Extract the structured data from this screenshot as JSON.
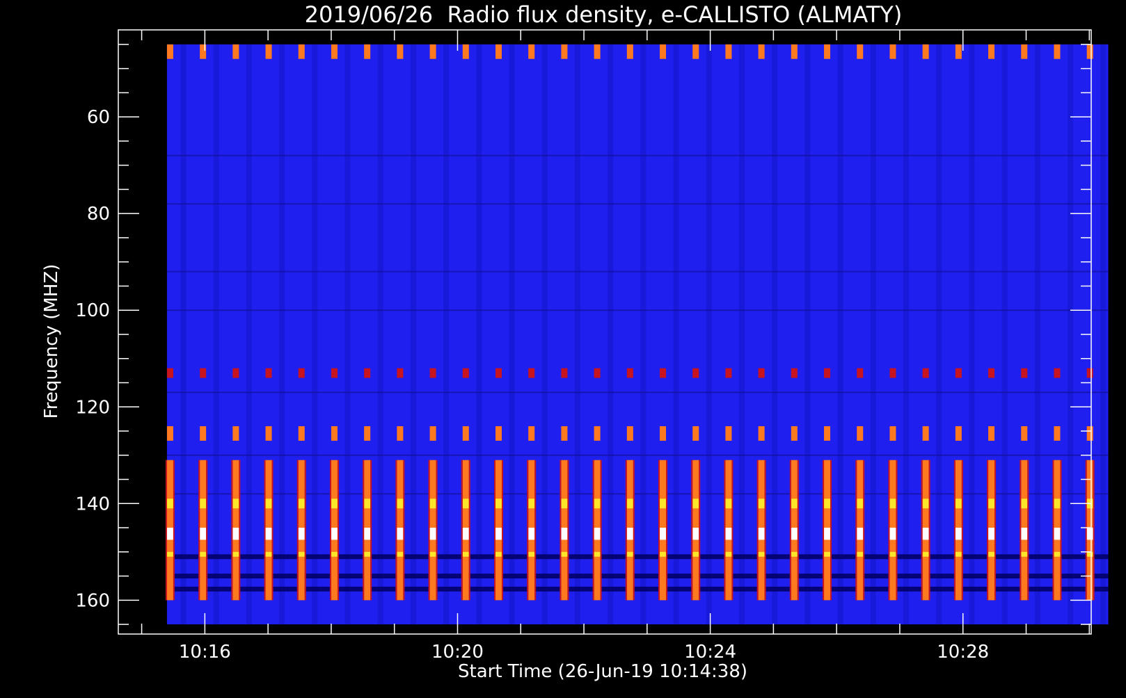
{
  "chart_data": {
    "type": "heatmap",
    "title": "2019/06/26  Radio flux density, e-CALLISTO (ALMATY)",
    "xlabel": "Start Time (26-Jun-19 10:14:38)",
    "ylabel": "Frequency (MHZ)",
    "x_tick_labels": [
      "10:16",
      "10:20",
      "10:24",
      "10:28"
    ],
    "x_tick_minutes": [
      16,
      20,
      24,
      28
    ],
    "x_range_minutes": [
      14.63,
      30.03
    ],
    "data_time_range_minutes": [
      15.4,
      30.3
    ],
    "y_tick_values": [
      60,
      80,
      100,
      120,
      140,
      160
    ],
    "y_range": [
      42,
      167
    ],
    "y_inverted": true,
    "data_freq_range": [
      45,
      165
    ],
    "pulse_period_minutes": 0.52,
    "pulse_bands_mhz": [
      {
        "from": 45,
        "to": 48,
        "level": "orange"
      },
      {
        "from": 112,
        "to": 114,
        "level": "red"
      },
      {
        "from": 124,
        "to": 127,
        "level": "orange"
      },
      {
        "from": 131,
        "to": 160,
        "level": "orange"
      },
      {
        "from": 139,
        "to": 141,
        "level": "yellow"
      },
      {
        "from": 145,
        "to": 147.5,
        "level": "white"
      },
      {
        "from": 150,
        "to": 151,
        "level": "yellow"
      }
    ],
    "dark_bands_mhz": [
      150.5,
      151.5,
      154.5,
      155.5,
      157.2,
      158.2
    ],
    "colors": {
      "background": "#1f1ff0",
      "pulse_red": "#c8141e",
      "pulse_orange": "#ff7a1e",
      "pulse_yellow": "#ffe628",
      "pulse_white": "#ffffff",
      "dark": "#000060"
    },
    "grid": false,
    "legend": "none"
  }
}
